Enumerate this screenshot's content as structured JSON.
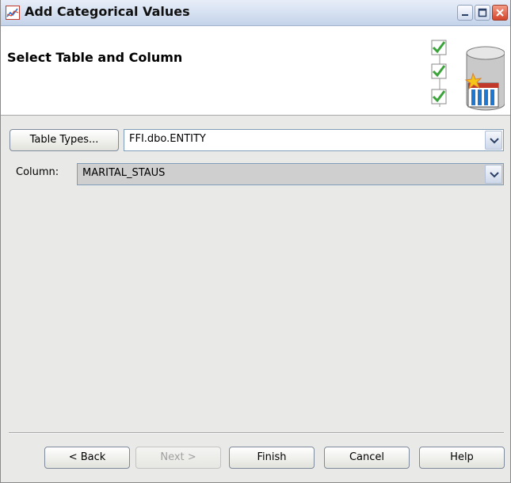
{
  "window": {
    "title": "Add Categorical Values",
    "app_icon": "line-chart-icon"
  },
  "header": {
    "title": "Select Table and Column",
    "graphic_icon": "database-checklist-icon"
  },
  "table_selector": {
    "button_label": "Table Types...",
    "selected_table": "FFI.dbo.ENTITY"
  },
  "column_selector": {
    "label": "Column:",
    "selected_column": "MARITAL_STAUS"
  },
  "footer": {
    "back_label": "< Back",
    "next_label": "Next >",
    "finish_label": "Finish",
    "cancel_label": "Cancel",
    "help_label": "Help"
  },
  "colors": {
    "titlebar_start": "#e8eef8",
    "titlebar_end": "#c4d3ea",
    "dialog_background": "#e9e9e7",
    "header_background": "#ffffff",
    "close_button": "#d2452a",
    "checkmark": "#3aa33a"
  }
}
